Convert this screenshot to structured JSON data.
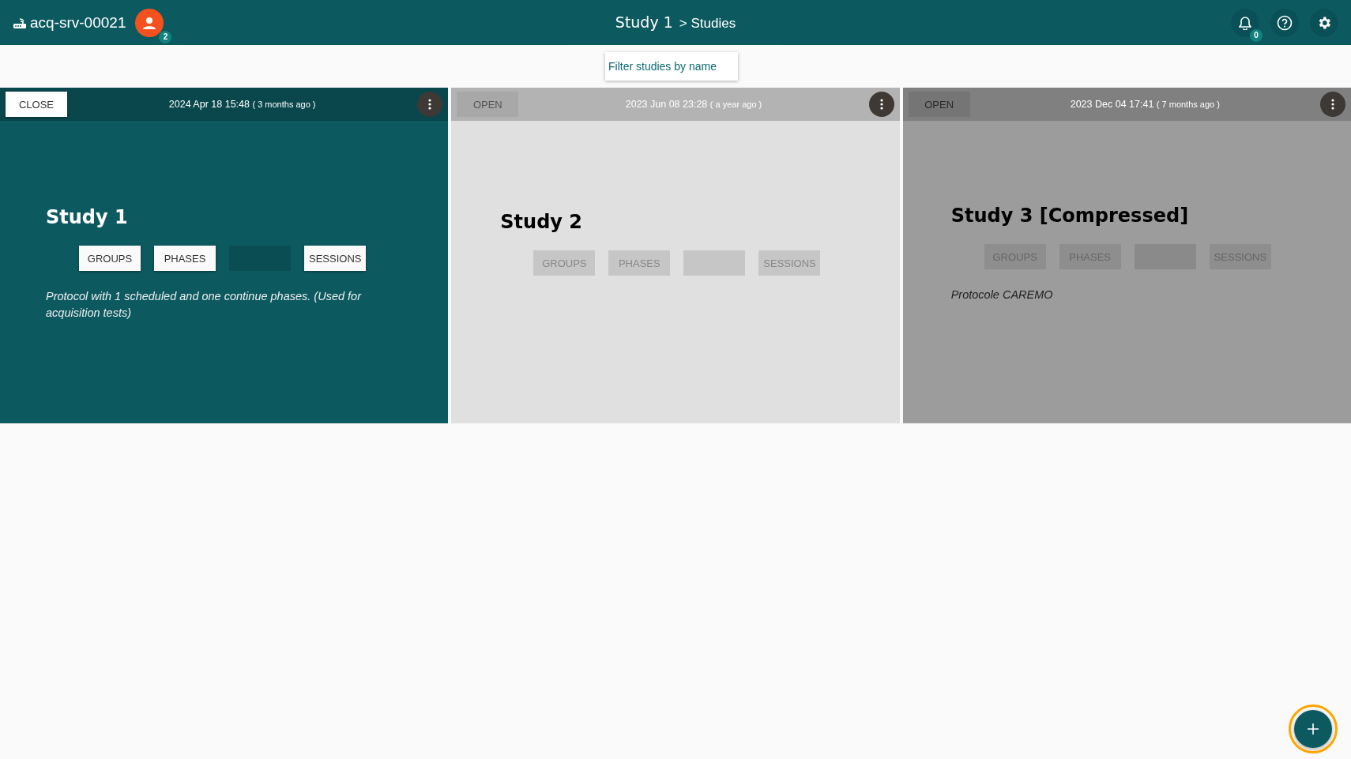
{
  "app_bar": {
    "server": "acq-srv-00021",
    "user_badge": "2",
    "title": "Study 1",
    "breadcrumb": "> Studies",
    "notifications_badge": "0"
  },
  "filter": {
    "placeholder": "Filter studies by name"
  },
  "studies": [
    {
      "kind": "active",
      "toggle": "CLOSE",
      "date": "2024 Apr 18 15:48",
      "ago": "( 3 months ago )",
      "name": "Study 1",
      "actions": [
        {
          "kind": "button",
          "label": "GROUPS"
        },
        {
          "kind": "button",
          "label": "PHASES"
        },
        {
          "kind": "blank"
        },
        {
          "kind": "button",
          "label": "SESSIONS"
        }
      ],
      "description": "Protocol with 1 scheduled and one continue phases. (Used for acquisition tests)"
    },
    {
      "kind": "closed",
      "toggle": "OPEN",
      "date": "2023 Jun 08 23:28",
      "ago": "( a year ago )",
      "name": "Study 2",
      "actions": [
        {
          "kind": "button",
          "label": "GROUPS"
        },
        {
          "kind": "button",
          "label": "PHASES"
        },
        {
          "kind": "blank"
        },
        {
          "kind": "button",
          "label": "SESSIONS"
        }
      ]
    },
    {
      "kind": "compressed",
      "toggle": "OPEN",
      "date": "2023 Dec 04 17:41",
      "ago": "( 7 months ago )",
      "name": "Study 3 [Compressed]",
      "actions": [
        {
          "kind": "button",
          "label": "GROUPS"
        },
        {
          "kind": "button",
          "label": "PHASES"
        },
        {
          "kind": "blank"
        },
        {
          "kind": "button",
          "label": "SESSIONS"
        }
      ],
      "description": "Protocole CAREMO"
    }
  ],
  "add_button": {
    "focused": true
  }
}
